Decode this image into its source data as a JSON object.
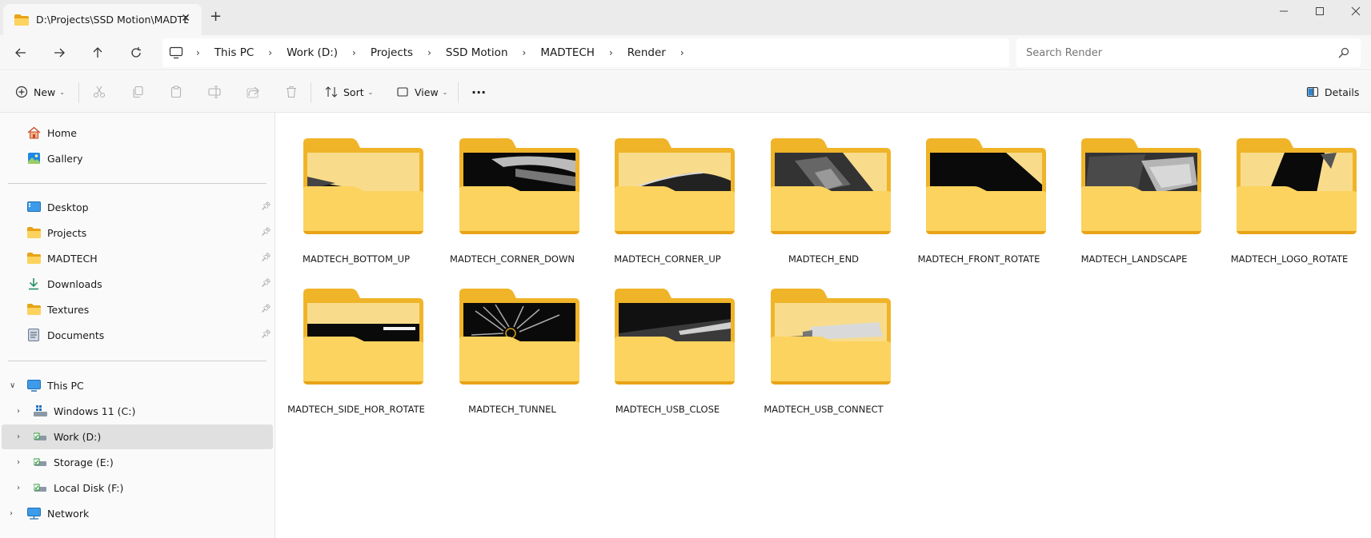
{
  "window": {
    "tab_title": "D:\\Projects\\SSD Motion\\MADTECH\\Render",
    "new_tab": "+",
    "close_tab": "✕"
  },
  "address": {
    "crumbs": [
      "This PC",
      "Work (D:)",
      "Projects",
      "SSD Motion",
      "MADTECH",
      "Render"
    ],
    "search_placeholder": "Search Render"
  },
  "toolbar": {
    "new_label": "New",
    "sort_label": "Sort",
    "view_label": "View",
    "more_label": "···",
    "details_label": "Details"
  },
  "sidebar": {
    "quick": [
      {
        "label": "Home"
      },
      {
        "label": "Gallery"
      }
    ],
    "pinned": [
      {
        "label": "Desktop"
      },
      {
        "label": "Projects"
      },
      {
        "label": "MADTECH"
      },
      {
        "label": "Downloads"
      },
      {
        "label": "Textures"
      },
      {
        "label": "Documents"
      }
    ],
    "this_pc": "This PC",
    "drives": [
      {
        "label": "Windows 11 (C:)"
      },
      {
        "label": "Work (D:)"
      },
      {
        "label": "Storage (E:)"
      },
      {
        "label": "Local Disk (F:)"
      }
    ],
    "network": "Network"
  },
  "folders": [
    {
      "name": "MADTECH_BOTTOM_UP"
    },
    {
      "name": "MADTECH_CORNER_DOWN"
    },
    {
      "name": "MADTECH_CORNER_UP"
    },
    {
      "name": "MADTECH_END"
    },
    {
      "name": "MADTECH_FRONT_ROTATE"
    },
    {
      "name": "MADTECH_LANDSCAPE"
    },
    {
      "name": "MADTECH_LOGO_ROTATE"
    },
    {
      "name": "MADTECH_SIDE_HOR_ROTATE"
    },
    {
      "name": "MADTECH_TUNNEL"
    },
    {
      "name": "MADTECH_USB_CLOSE"
    },
    {
      "name": "MADTECH_USB_CONNECT"
    }
  ],
  "colors": {
    "folder_back": "#f0b429",
    "folder_front": "#fcd35e",
    "accent": "#0067c0",
    "selected_bg": "#e0e0e0"
  }
}
